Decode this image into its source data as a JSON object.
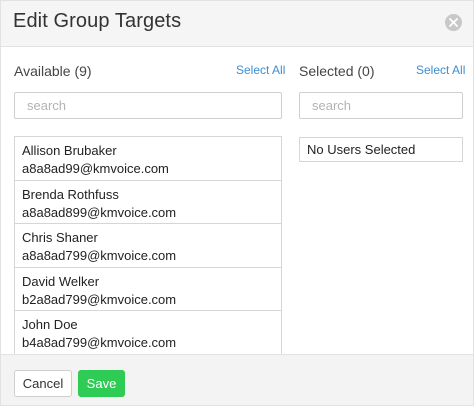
{
  "dialog": {
    "title": "Edit Group Targets",
    "close_icon": "close-circle-icon"
  },
  "available": {
    "label": "Available (9)",
    "select_all": "Select All",
    "search_placeholder": "search",
    "items": [
      {
        "name": "Allison Brubaker",
        "email": "a8a8ad99@kmvoice.com"
      },
      {
        "name": "Brenda Rothfuss",
        "email": "a8a8ad899@kmvoice.com"
      },
      {
        "name": "Chris Shaner",
        "email": "a8a8ad799@kmvoice.com"
      },
      {
        "name": "David Welker",
        "email": "b2a8ad799@kmvoice.com"
      },
      {
        "name": "John Doe",
        "email": "b4a8ad799@kmvoice.com"
      }
    ]
  },
  "selected": {
    "label": "Selected (0)",
    "select_all": "Select All",
    "search_placeholder": "search",
    "empty_text": "No Users Selected"
  },
  "footer": {
    "cancel_label": "Cancel",
    "save_label": "Save"
  },
  "colors": {
    "link": "#3c8ed3",
    "save_button": "#2ecc55",
    "header_bg": "#f5f5f5"
  }
}
